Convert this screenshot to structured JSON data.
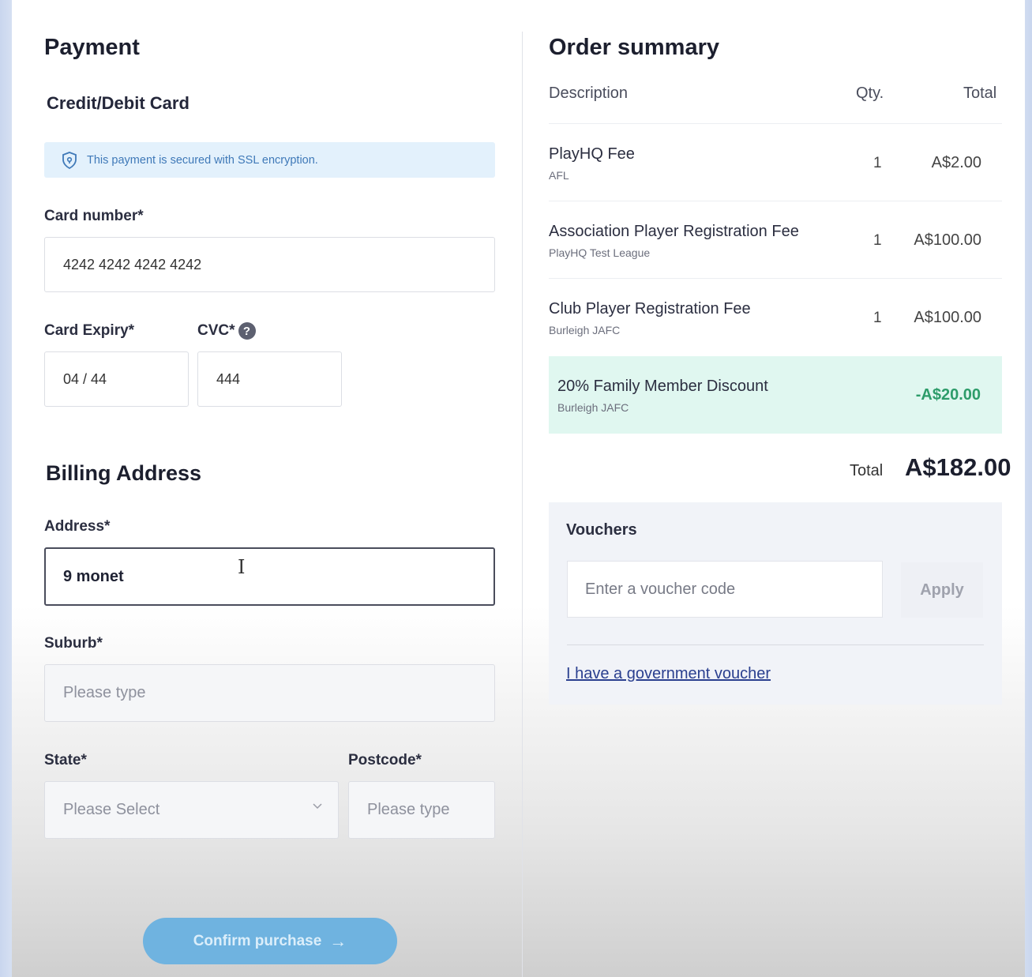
{
  "payment": {
    "title": "Payment",
    "method_title": "Credit/Debit Card",
    "ssl_notice": "This payment is secured with SSL encryption.",
    "card_number": {
      "label": "Card number*",
      "value": "4242 4242 4242 4242"
    },
    "card_expiry": {
      "label": "Card Expiry*",
      "value": "04 / 44"
    },
    "cvc": {
      "label": "CVC*",
      "value": "444",
      "help_icon": "?"
    }
  },
  "billing": {
    "title": "Billing Address",
    "address": {
      "label": "Address*",
      "value": "9 monet"
    },
    "suburb": {
      "label": "Suburb*",
      "placeholder": "Please type"
    },
    "state": {
      "label": "State*",
      "placeholder": "Please Select"
    },
    "postcode": {
      "label": "Postcode*",
      "placeholder": "Please type"
    }
  },
  "confirm": {
    "label": "Confirm purchase",
    "arrow": "→"
  },
  "order": {
    "title": "Order summary",
    "columns": {
      "description": "Description",
      "qty": "Qty.",
      "total": "Total"
    },
    "items": [
      {
        "name": "PlayHQ Fee",
        "sub": "AFL",
        "qty": "1",
        "total": "A$2.00"
      },
      {
        "name": "Association Player Registration Fee",
        "sub": "PlayHQ Test League",
        "qty": "1",
        "total": "A$100.00"
      },
      {
        "name": "Club Player Registration Fee",
        "sub": "Burleigh JAFC",
        "qty": "1",
        "total": "A$100.00"
      }
    ],
    "discount": {
      "name": "20% Family Member Discount",
      "sub": "Burleigh JAFC",
      "amount": "-A$20.00",
      "color": "#2d9c6a"
    },
    "total_label": "Total",
    "total_value": "A$182.00"
  },
  "vouchers": {
    "title": "Vouchers",
    "placeholder": "Enter a voucher code",
    "apply_label": "Apply",
    "gov_link": "I have a government voucher"
  },
  "colors": {
    "accent": "#6fb3e0",
    "ssl_bg": "#e3f1fc",
    "discount_bg": "#e0f7f0"
  },
  "icons": {
    "ssl": "shield-lock-icon",
    "help": "question-circle-icon",
    "dropdown": "chevron-down-icon",
    "text_cursor": "text-cursor-icon"
  }
}
